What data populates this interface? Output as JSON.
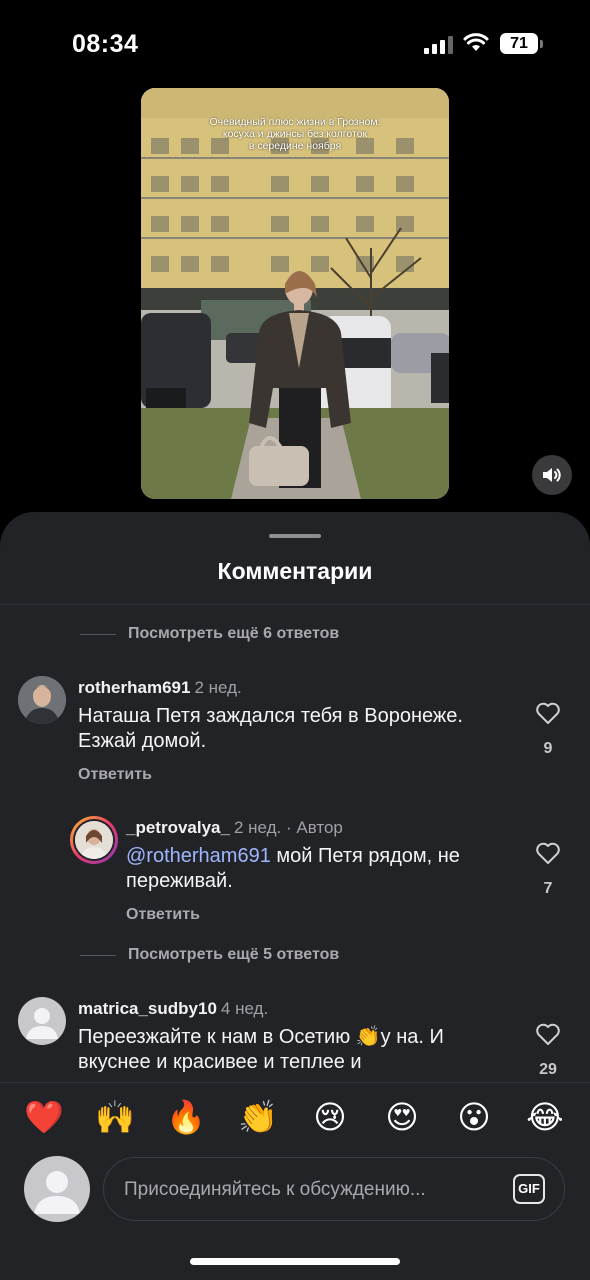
{
  "status_bar": {
    "time": "08:34",
    "battery": "71"
  },
  "video": {
    "caption_lines": [
      "Очевидный плюс жизни в Грозном:",
      "косуха и джинсы без колготок",
      "в середине ноября"
    ]
  },
  "sheet": {
    "title": "Комментарии",
    "more_replies_top": "Посмотреть ещё 6 ответов",
    "more_replies_mid": "Посмотреть ещё 5 ответов"
  },
  "comments": [
    {
      "username": "rotherham691",
      "time": "2 нед.",
      "text": "Наташа Петя заждался тебя в Воронеже. Езжай домой.",
      "reply_label": "Ответить",
      "likes": "9"
    },
    {
      "username": "_petrovalya_",
      "time": "2 нед.",
      "author_label": "· Автор",
      "mention": "@rotherham691",
      "text": " мой Петя рядом, не переживай.",
      "reply_label": "Ответить",
      "likes": "7"
    },
    {
      "username": "matrica_sudby10",
      "time": "4 нед.",
      "text": "Переезжайте к нам в Осетию 👏у на. И вкуснее и красивее и теплее и",
      "likes": "29"
    }
  ],
  "reactions": [
    "❤️",
    "🙌",
    "🔥",
    "👏",
    "😢",
    "😍",
    "😮",
    "😂"
  ],
  "composer": {
    "placeholder": "Присоединяйтесь к обсуждению...",
    "gif_label": "GIF"
  },
  "colors": {
    "background": "#000000",
    "sheet": "#212327",
    "mention": "#9fb6ff",
    "secondary_text": "#a8a8ad"
  },
  "icons": [
    "signal-icon",
    "wifi-icon",
    "battery-icon",
    "speaker-icon",
    "heart-outline-icon",
    "default-avatar-icon",
    "gif-icon"
  ]
}
